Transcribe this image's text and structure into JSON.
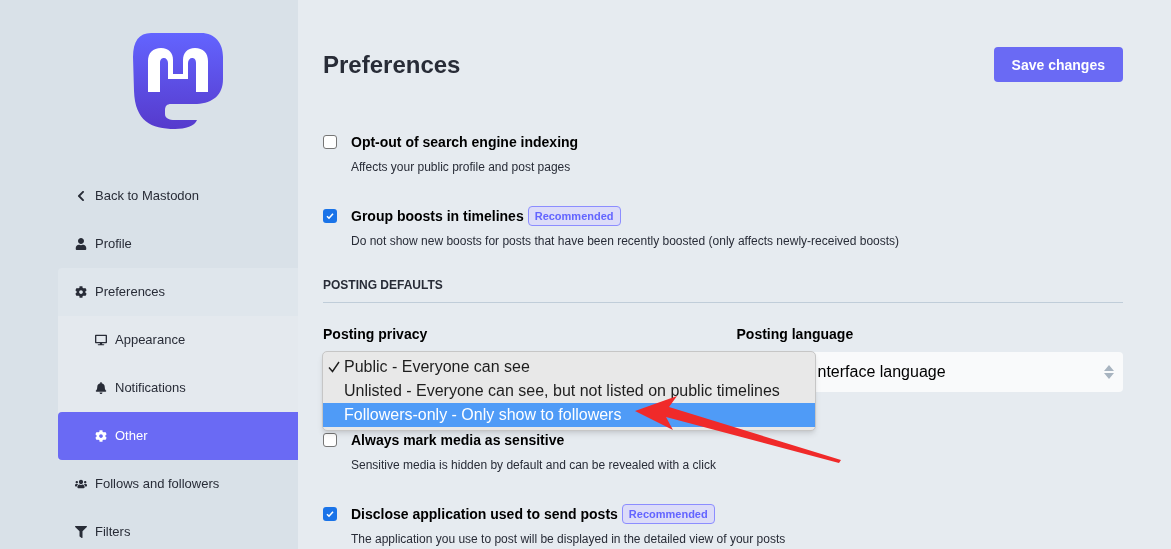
{
  "sidebar": {
    "items": [
      {
        "label": "Back to Mastodon",
        "selected": false
      },
      {
        "label": "Profile",
        "selected": false
      },
      {
        "label": "Preferences",
        "selected": false,
        "expanded": true,
        "children": [
          {
            "label": "Appearance",
            "selected": false
          },
          {
            "label": "Notifications",
            "selected": false
          },
          {
            "label": "Other",
            "selected": true
          }
        ]
      },
      {
        "label": "Follows and followers",
        "selected": false
      },
      {
        "label": "Filters",
        "selected": false
      }
    ]
  },
  "header": {
    "title": "Preferences",
    "save_button": "Save changes"
  },
  "options_top": [
    {
      "label": "Opt-out of search engine indexing",
      "hint": "Affects your public profile and post pages",
      "checked": false
    },
    {
      "label": "Group boosts in timelines",
      "badge": "Recommended",
      "hint": "Do not show new boosts for posts that have been recently boosted (only affects newly-received boosts)",
      "checked": true
    }
  ],
  "posting_defaults": {
    "heading": "POSTING DEFAULTS",
    "privacy": {
      "label": "Posting privacy",
      "dropdown": [
        {
          "label": "Public - Everyone can see",
          "current": true,
          "selected": false
        },
        {
          "label": "Unlisted - Everyone can see, but not listed on public timelines",
          "current": false,
          "selected": false
        },
        {
          "label": "Followers-only - Only show to followers",
          "current": false,
          "selected": true
        }
      ]
    },
    "language": {
      "label": "Posting language",
      "value": "nterface language"
    }
  },
  "options_bottom": [
    {
      "label": "Always mark media as sensitive",
      "hint": "Sensitive media is hidden by default and can be revealed with a click",
      "checked": false
    },
    {
      "label": "Disclose application used to send posts",
      "badge": "Recommended",
      "hint": "The application you use to post will be displayed in the detailed view of your posts",
      "checked": true
    }
  ]
}
